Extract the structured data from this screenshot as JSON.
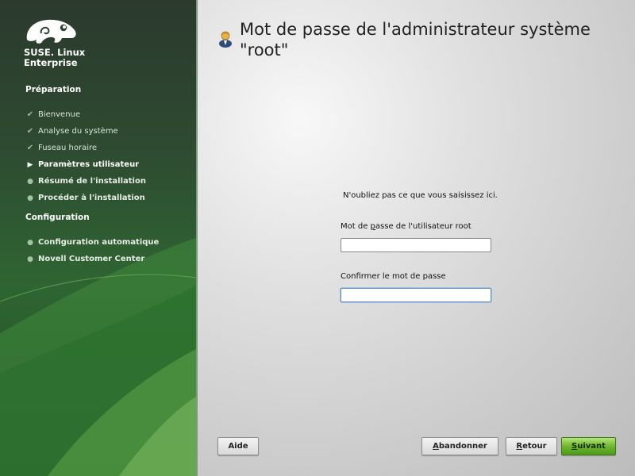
{
  "sidebar": {
    "brand_line1": "SUSE. Linux",
    "brand_line2": "Enterprise",
    "sections": [
      {
        "title": "Préparation",
        "items": [
          {
            "label": "Bienvenue",
            "state": "done",
            "icon": "check-icon"
          },
          {
            "label": "Analyse du système",
            "state": "done",
            "icon": "check-icon"
          },
          {
            "label": "Fuseau horaire",
            "state": "done",
            "icon": "check-icon"
          },
          {
            "label": "Paramètres utilisateur",
            "state": "current",
            "icon": "arrow-right-icon"
          },
          {
            "label": "Résumé de l'installation",
            "state": "pending",
            "icon": "bullet-icon"
          },
          {
            "label": "Procéder à l'installation",
            "state": "pending",
            "icon": "bullet-icon"
          }
        ]
      },
      {
        "title": "Configuration",
        "items": [
          {
            "label": "Configuration automatique",
            "state": "pending",
            "icon": "bullet-icon"
          },
          {
            "label": "Novell Customer Center",
            "state": "pending",
            "icon": "bullet-icon"
          }
        ]
      }
    ]
  },
  "main": {
    "title": "Mot de passe de l'administrateur système \"root\"",
    "title_icon": "user-icon",
    "hint": "N'oubliez pas ce que vous saisissez ici.",
    "password_label_pre": "Mot de ",
    "password_label_accel": "p",
    "password_label_post": "asse de l'utilisateur root",
    "password_value": "",
    "confirm_label": "Confirmer le mot de passe",
    "confirm_value": ""
  },
  "buttons": {
    "help": "Aide",
    "abort_accel": "A",
    "abort_rest": "bandonner",
    "back_accel": "R",
    "back_rest": "etour",
    "next_accel": "S",
    "next_rest": "uivant"
  },
  "colors": {
    "sidebar_green": "#2f6532",
    "accent_next": "#6eb72e",
    "content_bg": "#d4d4d4"
  }
}
